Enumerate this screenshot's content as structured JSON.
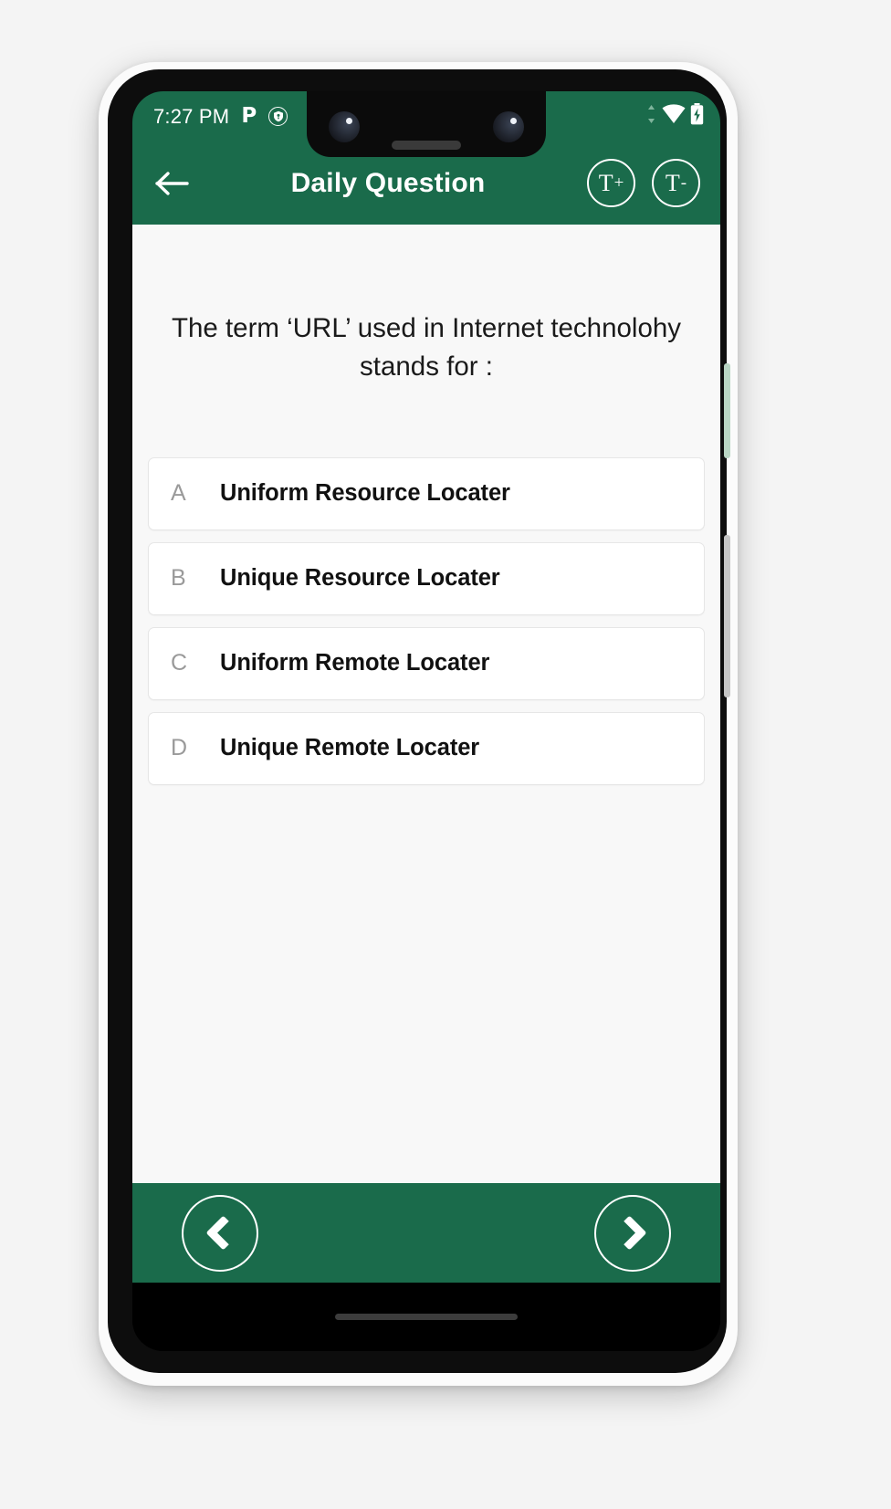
{
  "status_bar": {
    "time": "7:27 PM",
    "left_icons": [
      {
        "name": "pandora-icon",
        "glyph": "P"
      },
      {
        "name": "vpn-shield-icon",
        "glyph": "shield"
      }
    ],
    "right_icons": [
      {
        "name": "mobile-data-arrows-icon",
        "glyph": "data"
      },
      {
        "name": "wifi-icon",
        "glyph": "wifi"
      },
      {
        "name": "battery-charging-icon",
        "glyph": "battery"
      }
    ]
  },
  "app_bar": {
    "back_label": "←",
    "title": "Daily Question",
    "text_increase_label": "T",
    "text_increase_sup": "+",
    "text_decrease_label": "T",
    "text_decrease_sup": "-"
  },
  "question": {
    "text": "The term ‘URL’ used in Internet technolohy stands for :"
  },
  "options": [
    {
      "letter": "A",
      "text": "Uniform Resource Locater"
    },
    {
      "letter": "B",
      "text": "Unique Resource Locater"
    },
    {
      "letter": "C",
      "text": "Uniform Remote Locater"
    },
    {
      "letter": "D",
      "text": "Unique Remote Locater"
    }
  ],
  "bottom_nav": {
    "previous_label": "‹",
    "next_label": "›"
  },
  "colors": {
    "brand_green": "#1a6b4b",
    "content_bg": "#f8f8f8",
    "option_bg": "#ffffff",
    "option_letter": "#9a9a9a",
    "text_primary": "#111111"
  }
}
